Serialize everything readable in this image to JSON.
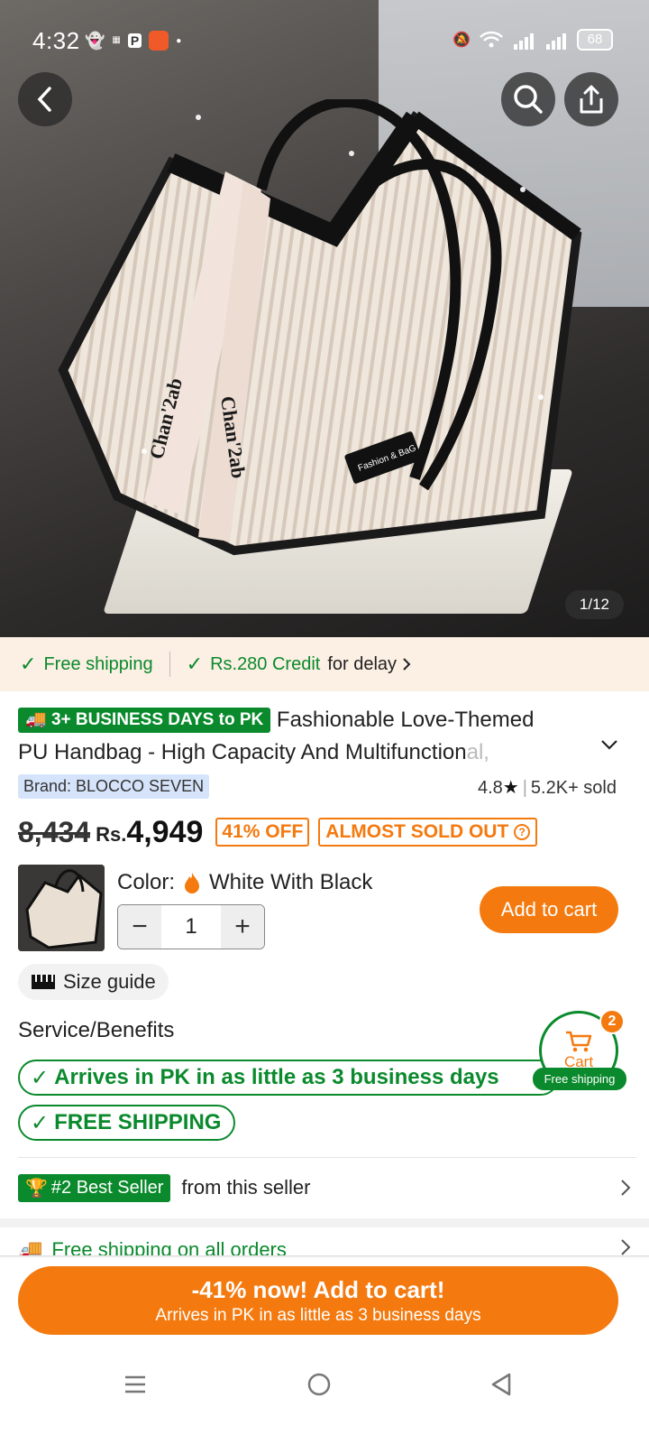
{
  "status_bar": {
    "time": "4:32",
    "left_icons": [
      "snapchat-icon",
      "temu-icon",
      "parking-icon",
      "app-icon",
      "dot-icon"
    ],
    "right_icons": [
      "mute-icon",
      "wifi-icon",
      "signal-4g-icon",
      "signal-4-5g-icon"
    ],
    "battery": "68"
  },
  "gallery": {
    "counter": "1/12",
    "bag_strap_text": "Chan'2ab",
    "bag_label_text": "Fashion & BaG"
  },
  "shipping_strip": {
    "free_shipping": "Free shipping",
    "credit_amount": "Rs.280 Credit",
    "credit_suffix": "for delay"
  },
  "product": {
    "delivery_badge": "3+ BUSINESS DAYS to PK",
    "title_line1": "Fashionable Love-Themed",
    "title_line2": "PU Handbag - High Capacity And Multifunction",
    "title_fade": "al,",
    "brand": "Brand: BLOCCO SEVEN",
    "rating": "4.8",
    "sold": "5.2K+ sold",
    "old_price": "8,434",
    "currency": "Rs.",
    "price": "4,949",
    "discount": "41% OFF",
    "stock_status": "ALMOST SOLD OUT"
  },
  "variant": {
    "color_label": "Color:",
    "color_value": "White With Black",
    "quantity": "1",
    "add_to_cart": "Add to cart"
  },
  "size_guide": "Size guide",
  "service": {
    "title": "Service/Benefits",
    "pill1": "Arrives in PK in as little as 3 business days",
    "pill2": "FREE SHIPPING"
  },
  "cart_float": {
    "label": "Cart",
    "count": "2",
    "free_tag": "Free shipping"
  },
  "seller": {
    "badge": "#2 Best Seller",
    "text": "from this seller"
  },
  "free_all_orders": "Free shipping on all orders",
  "cta": {
    "line1": "-41% now! Add to cart!",
    "line2": "Arrives in PK in as little as 3 business days"
  },
  "colors": {
    "accent_orange": "#f47a0f",
    "green": "#0a8a2c",
    "strip_bg": "#fcefe4"
  }
}
